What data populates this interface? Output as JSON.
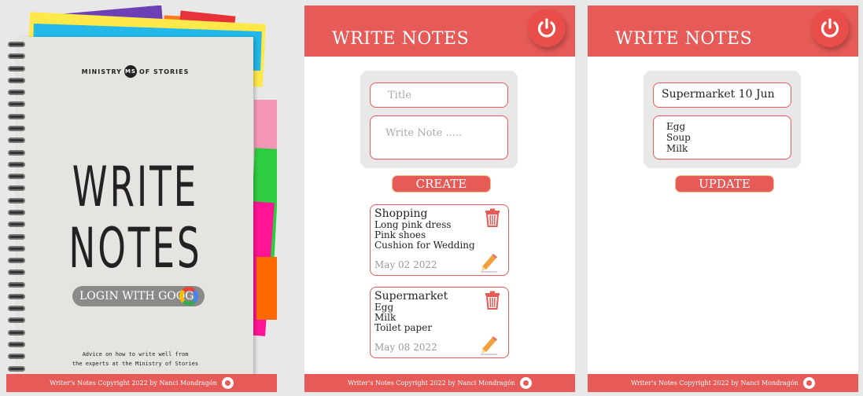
{
  "login": {
    "brand_left": "MINISTRY",
    "brand_badge": "MS",
    "brand_right": "OF STORIES",
    "cover_word1": "WRITE",
    "cover_word2": "NOTES",
    "login_button": "LOGIN WITH GOOG",
    "advice_line1": "Advice on how to write well from",
    "advice_line2": "the experts at the Ministry of Stories",
    "footer": "Writer's Notes Copyright 2022 by  Nanci Mondragón"
  },
  "create": {
    "header_title": "WRITE NOTES",
    "title_placeholder": "Title",
    "note_placeholder": "Write Note .....",
    "button": "CREATE",
    "notes": [
      {
        "title": "Shopping",
        "lines": [
          "Long pink dress",
          "Pink   shoes",
          "Cushion for Wedding"
        ],
        "date": "May 02 2022"
      },
      {
        "title": "Supermarket",
        "lines": [
          "Egg",
          "Milk",
          "Toilet paper"
        ],
        "date": "May 08 2022"
      }
    ],
    "footer": "Writer's Notes Copyright 2022 by  Nanci Mondragón"
  },
  "edit": {
    "header_title": "WRITE NOTES",
    "title_value": "Supermarket 10 Jun",
    "note_lines": [
      "Egg",
      "Soup",
      "Milk"
    ],
    "button": "UPDATE",
    "footer": "Writer's Notes Copyright 2022 by  Nanci Mondragón"
  },
  "colors": {
    "accent": "#e65a57",
    "panel_bg": "#e8e8e8"
  }
}
